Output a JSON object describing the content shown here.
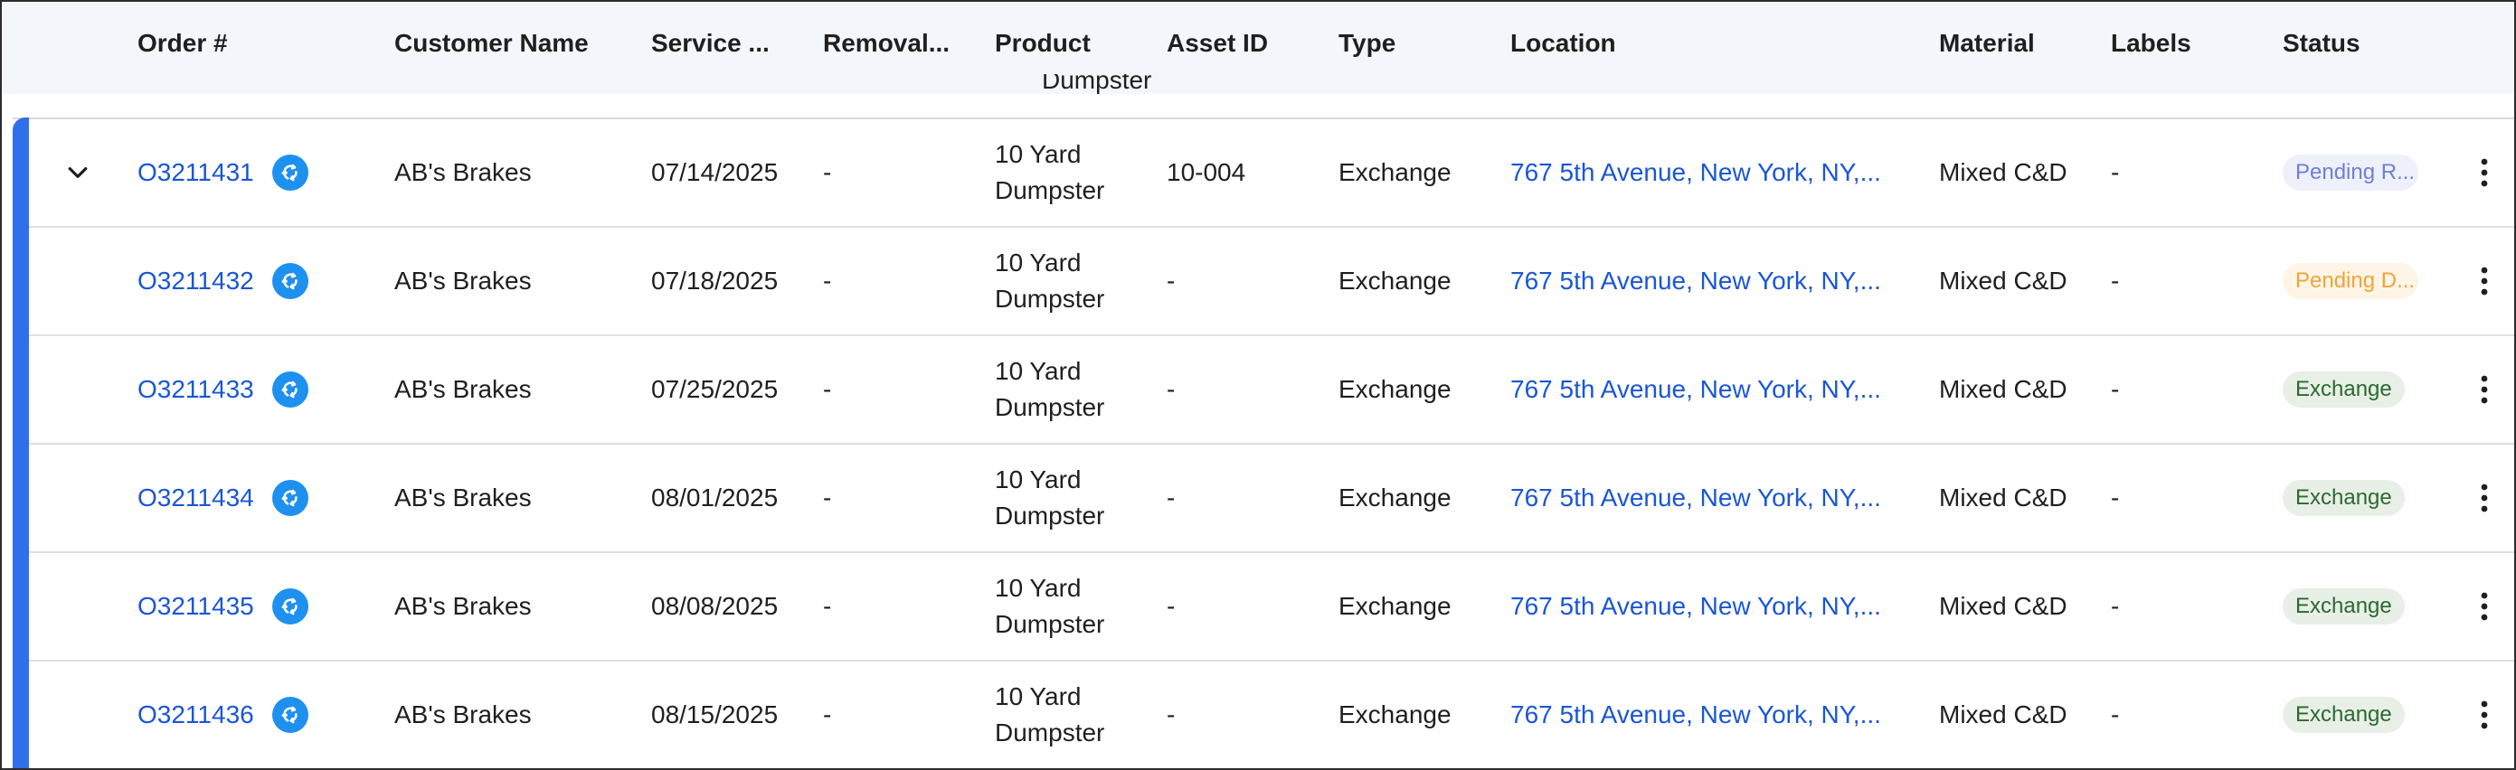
{
  "header": {
    "order": "Order #",
    "customer": "Customer Name",
    "service": "Service ...",
    "removal": "Removal...",
    "product": "Product",
    "asset": "Asset ID",
    "type": "Type",
    "location": "Location",
    "material": "Material",
    "labels": "Labels",
    "status": "Status"
  },
  "partial_prev_row_text": "Dumpster",
  "rows": [
    {
      "order": "O3211431",
      "customer": "AB's Brakes",
      "service": "07/14/2025",
      "removal": "-",
      "product_line1": "10 Yard",
      "product_line2": "Dumpster",
      "asset": "10-004",
      "type": "Exchange",
      "location": "767 5th Avenue, New York, NY,...",
      "material": "Mixed C&D",
      "labels": "-",
      "status": "Pending R..."
    },
    {
      "order": "O3211432",
      "customer": "AB's Brakes",
      "service": "07/18/2025",
      "removal": "-",
      "product_line1": "10 Yard",
      "product_line2": "Dumpster",
      "asset": "-",
      "type": "Exchange",
      "location": "767 5th Avenue, New York, NY,...",
      "material": "Mixed C&D",
      "labels": "-",
      "status": "Pending D..."
    },
    {
      "order": "O3211433",
      "customer": "AB's Brakes",
      "service": "07/25/2025",
      "removal": "-",
      "product_line1": "10 Yard",
      "product_line2": "Dumpster",
      "asset": "-",
      "type": "Exchange",
      "location": "767 5th Avenue, New York, NY,...",
      "material": "Mixed C&D",
      "labels": "-",
      "status": "Exchange"
    },
    {
      "order": "O3211434",
      "customer": "AB's Brakes",
      "service": "08/01/2025",
      "removal": "-",
      "product_line1": "10 Yard",
      "product_line2": "Dumpster",
      "asset": "-",
      "type": "Exchange",
      "location": "767 5th Avenue, New York, NY,...",
      "material": "Mixed C&D",
      "labels": "-",
      "status": "Exchange"
    },
    {
      "order": "O3211435",
      "customer": "AB's Brakes",
      "service": "08/08/2025",
      "removal": "-",
      "product_line1": "10 Yard",
      "product_line2": "Dumpster",
      "asset": "-",
      "type": "Exchange",
      "location": "767 5th Avenue, New York, NY,...",
      "material": "Mixed C&D",
      "labels": "-",
      "status": "Exchange"
    },
    {
      "order": "O3211436",
      "customer": "AB's Brakes",
      "service": "08/15/2025",
      "removal": "-",
      "product_line1": "10 Yard",
      "product_line2": "Dumpster",
      "asset": "-",
      "type": "Exchange",
      "location": "767 5th Avenue, New York, NY,...",
      "material": "Mixed C&D",
      "labels": "-",
      "status": "Exchange"
    }
  ],
  "icons": {
    "expand": "chevron-down-icon",
    "recurring": "recurring-icon",
    "more": "more-vertical-icon"
  },
  "colors": {
    "accent": "#2f6fe8",
    "link": "#1a56d6",
    "recurring_icon": "#1e90f0",
    "pending_r_bg": "#eef0fb",
    "pending_r_fg": "#6e7fd8",
    "pending_d_bg": "#fff5e6",
    "pending_d_fg": "#f2a23a",
    "exchange_bg": "#e8efe6",
    "exchange_fg": "#2a6a2f"
  }
}
